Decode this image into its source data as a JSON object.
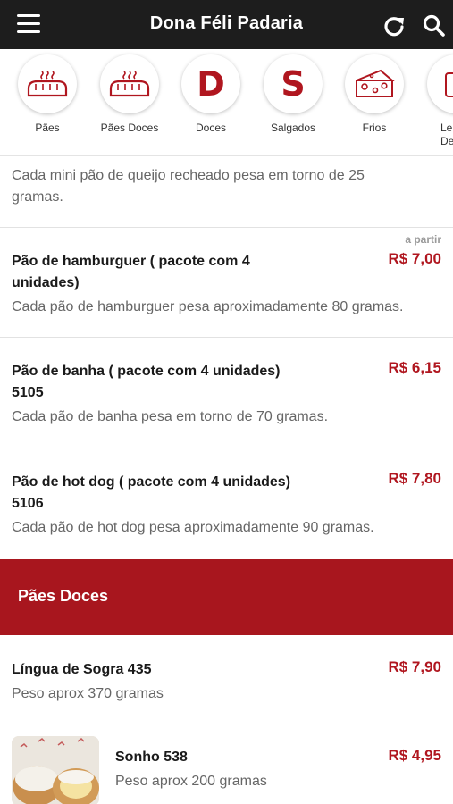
{
  "header": {
    "title": "Dona Féli Padaria",
    "menu_icon": "hamburger-menu-icon",
    "refresh_icon": "refresh-icon",
    "search_icon": "search-icon"
  },
  "categories": [
    {
      "label": "Pães",
      "icon": "bread-icon"
    },
    {
      "label": "Pães Doces",
      "icon": "bread-icon"
    },
    {
      "label": "Doces",
      "letter": "D"
    },
    {
      "label": "Salgados",
      "letter": "S"
    },
    {
      "label": "Frios",
      "icon": "cheese-icon"
    },
    {
      "label": "Le\nDeri",
      "icon": "partial-icon"
    }
  ],
  "items": [
    {
      "desc": "Cada mini pão de queijo recheado pesa em torno de 25 gramas."
    },
    {
      "name": "Pão de hamburguer ( pacote com 4 unidades)",
      "desc": "Cada pão de hamburguer pesa aproximadamente 80 gramas.",
      "price": "R$ 7,00",
      "from": "a partir"
    },
    {
      "name": "Pão de banha ( pacote com 4 unidades) 5105",
      "desc": "Cada pão de banha pesa em torno de 70 gramas.",
      "price": "R$ 6,15"
    },
    {
      "name": "Pão de hot dog ( pacote com 4 unidades) 5106",
      "desc": "Cada pão de hot dog pesa aproximadamente 90 gramas.",
      "price": "R$ 7,80"
    }
  ],
  "section": {
    "title": "Pães Doces"
  },
  "sweet_items": [
    {
      "name": "Língua de Sogra 435",
      "desc": "Peso aprox 370 gramas",
      "price": "R$ 7,90"
    },
    {
      "name": "Sonho 538",
      "desc": "Peso aprox 200 gramas",
      "price": "R$ 4,95",
      "image": "sonho-photo"
    }
  ],
  "colors": {
    "accent": "#b0161f",
    "section_bg": "#a8161e",
    "topbar_bg": "#1d1d1d"
  }
}
